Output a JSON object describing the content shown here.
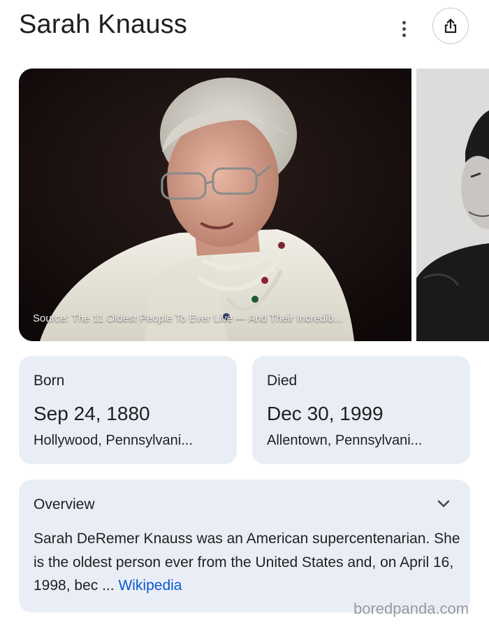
{
  "header": {
    "title": "Sarah Knauss",
    "more_icon": "more-vert-icon",
    "share_icon": "share-icon"
  },
  "images": {
    "main_caption": "Source: The 11 Oldest People To Ever Live — And Their Incredib...",
    "main_image": "photo of elderly woman with glasses and pearl necklaces",
    "second_image": "black-and-white portrait photo"
  },
  "born": {
    "label": "Born",
    "date": "Sep 24, 1880",
    "place": "Hollywood, Pennsylvani..."
  },
  "died": {
    "label": "Died",
    "date": "Dec 30, 1999",
    "place": "Allentown, Pennsylvani..."
  },
  "overview": {
    "label": "Overview",
    "expand_icon": "chevron-down-icon",
    "text": "Sarah DeRemer Knauss was an American supercentenarian. She is the oldest person ever from the United States and, on April 16, 1998, bec",
    "ellipsis": " ... ",
    "link_label": "Wikipedia"
  },
  "watermark": "boredpanda.com",
  "colors": {
    "card_bg": "#e9eef6",
    "link": "#0b57d0",
    "text": "#1f1f1f"
  }
}
